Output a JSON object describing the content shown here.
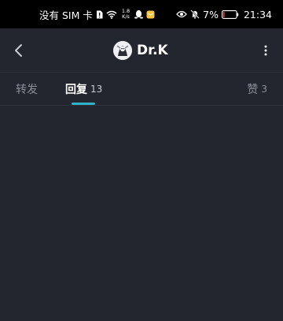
{
  "status_bar": {
    "carrier": "没有 SIM 卡",
    "net_speed_value": "1.8",
    "net_speed_unit": "K/s",
    "battery_percent": "7%",
    "time": "21:34"
  },
  "header": {
    "title": "Dr.K",
    "icons": [
      "chevron-left-icon",
      "avatar",
      "more-vertical-icon"
    ]
  },
  "tabs": [
    {
      "label": "转发",
      "count": ""
    },
    {
      "label": "回复",
      "count": "13",
      "active": true
    },
    {
      "label": "赞",
      "count": "3"
    }
  ],
  "colors": {
    "background": "#23262f",
    "status_bar": "#000000",
    "accent": "#2db4c9",
    "inactive_text": "#8b8f99",
    "battery_low": "#e0443a"
  }
}
